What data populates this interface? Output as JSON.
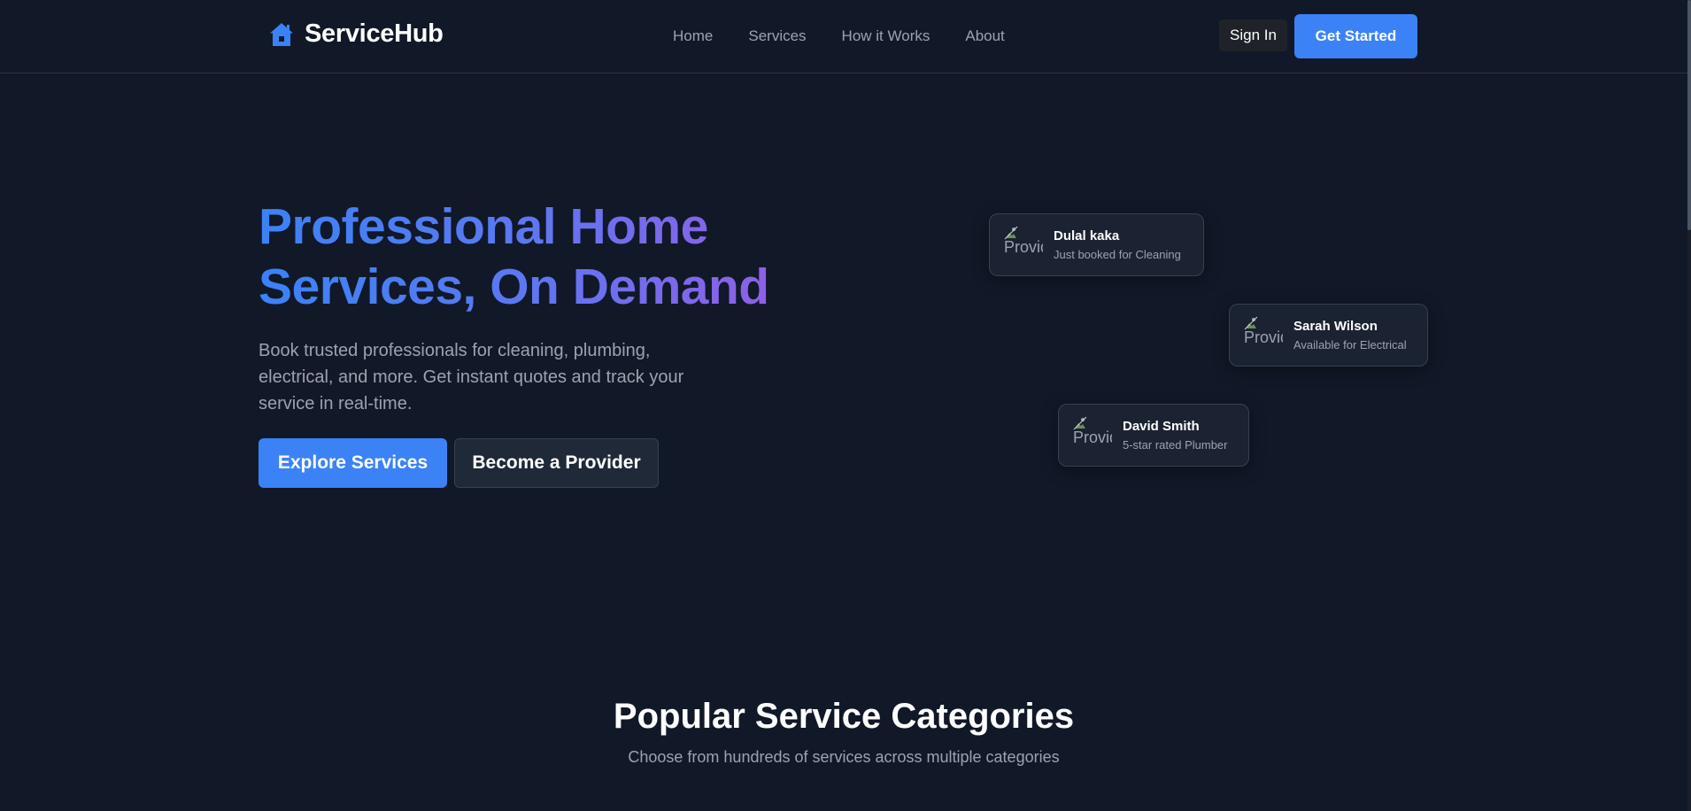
{
  "brand": {
    "name": "ServiceHub",
    "icon": "house-icon",
    "accent_color": "#3b82f6"
  },
  "nav": {
    "links": [
      "Home",
      "Services",
      "How it Works",
      "About"
    ],
    "sign_in_label": "Sign In",
    "get_started_label": "Get Started"
  },
  "hero": {
    "title_line1": "Professional Home",
    "title_line2": "Services, On Demand",
    "subtitle": "Book trusted professionals for cleaning, plumbing, electrical, and more. Get instant quotes and track your service in real-time.",
    "primary_cta": "Explore Services",
    "secondary_cta": "Become a Provider"
  },
  "activity_cards": [
    {
      "name": "Dulal kaka",
      "status": "Just booked for Cleaning",
      "avatar_alt": "Provider"
    },
    {
      "name": "Sarah Wilson",
      "status": "Available for Electrical",
      "avatar_alt": "Provider"
    },
    {
      "name": "David Smith",
      "status": "5-star rated Plumber",
      "avatar_alt": "Provider"
    }
  ],
  "categories": {
    "title": "Popular Service Categories",
    "subtitle": "Choose from hundreds of services across multiple categories"
  }
}
